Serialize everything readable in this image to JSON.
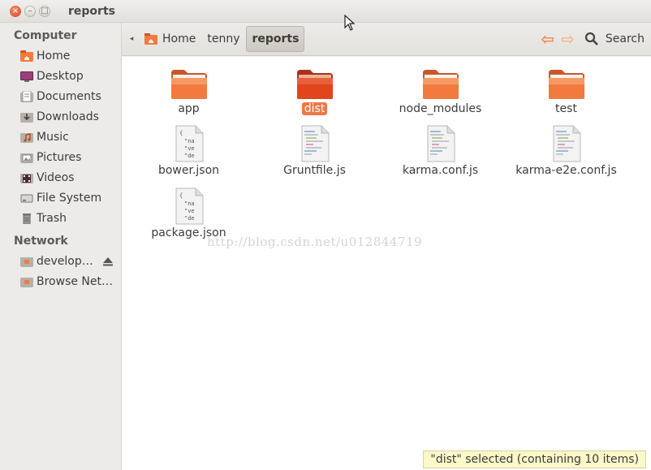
{
  "window": {
    "title": "reports",
    "close_glyph": "×",
    "min_glyph": "–",
    "max_glyph": "□"
  },
  "sidebar": {
    "headings": [
      "Computer",
      "Network"
    ],
    "computer_items": [
      {
        "label": "Home",
        "icon": "home-folder-icon"
      },
      {
        "label": "Desktop",
        "icon": "desktop-icon"
      },
      {
        "label": "Documents",
        "icon": "documents-folder-icon"
      },
      {
        "label": "Downloads",
        "icon": "downloads-folder-icon"
      },
      {
        "label": "Music",
        "icon": "music-folder-icon"
      },
      {
        "label": "Pictures",
        "icon": "pictures-folder-icon"
      },
      {
        "label": "Videos",
        "icon": "videos-folder-icon"
      },
      {
        "label": "File System",
        "icon": "file-system-icon"
      },
      {
        "label": "Trash",
        "icon": "trash-icon"
      }
    ],
    "network_items": [
      {
        "label": "develop…",
        "icon": "network-share-icon",
        "eject": true
      },
      {
        "label": "Browse Net…",
        "icon": "browse-network-icon"
      }
    ]
  },
  "toolbar": {
    "back_glyph": "◂",
    "breadcrumbs": [
      "Home",
      "tenny",
      "reports"
    ],
    "back_arrow": "⇦",
    "forward_arrow": "⇨",
    "search_label": "Search"
  },
  "files": [
    {
      "name": "app",
      "type": "folder"
    },
    {
      "name": "dist",
      "type": "folder",
      "selected": true
    },
    {
      "name": "node_modules",
      "type": "folder"
    },
    {
      "name": "test",
      "type": "folder"
    },
    {
      "name": "bower.json",
      "type": "json"
    },
    {
      "name": "Gruntfile.js",
      "type": "js"
    },
    {
      "name": "karma.conf.js",
      "type": "js"
    },
    {
      "name": "karma-e2e.conf.js",
      "type": "js"
    },
    {
      "name": "package.json",
      "type": "json"
    }
  ],
  "json_preview": [
    "{",
    "\"na",
    "\"ve",
    "\"de"
  ],
  "watermark": "http://blog.csdn.net/u012844719",
  "status": "\"dist\" selected (containing 10 items)",
  "colors": {
    "accent": "#f07746",
    "folder": "#f27a3f",
    "folder_selected": "#e0451c"
  }
}
